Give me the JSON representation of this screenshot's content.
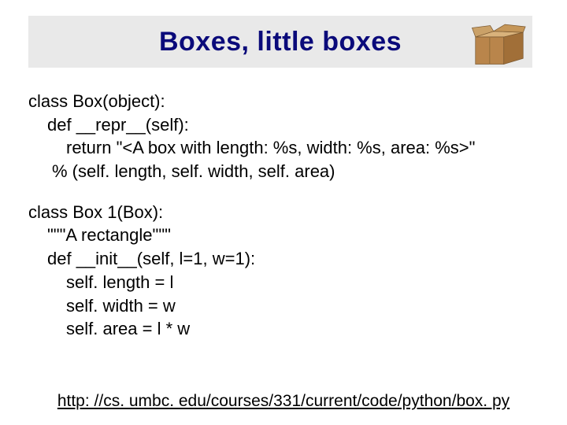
{
  "title": "Boxes, little boxes",
  "code1": {
    "l1": "class Box(object):",
    "l2": "def __repr__(self):",
    "l3": "return \"<A box with length: %s, width: %s, area: %s>\"",
    "l4": "% (self. length, self. width, self. area)"
  },
  "code2": {
    "l1": "class Box 1(Box):",
    "l2": "\"\"\"A rectangle\"\"\"",
    "l3": "def __init__(self, l=1, w=1):",
    "l4": "self. length = l",
    "l5": "self. width = w",
    "l6": "self. area = l * w"
  },
  "footer_link": "http: //cs. umbc. edu/courses/331/current/code/python/box. py"
}
